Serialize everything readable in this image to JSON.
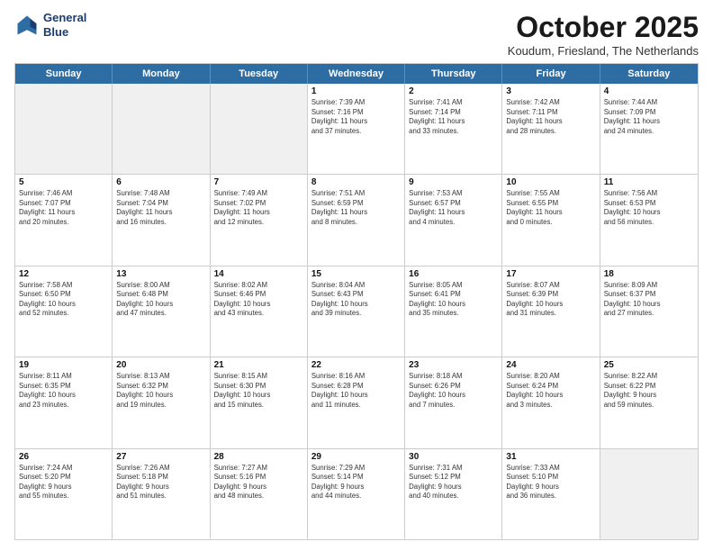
{
  "header": {
    "logo_line1": "General",
    "logo_line2": "Blue",
    "month": "October 2025",
    "location": "Koudum, Friesland, The Netherlands"
  },
  "days": [
    "Sunday",
    "Monday",
    "Tuesday",
    "Wednesday",
    "Thursday",
    "Friday",
    "Saturday"
  ],
  "rows": [
    [
      {
        "day": "",
        "info": ""
      },
      {
        "day": "",
        "info": ""
      },
      {
        "day": "",
        "info": ""
      },
      {
        "day": "1",
        "info": "Sunrise: 7:39 AM\nSunset: 7:16 PM\nDaylight: 11 hours\nand 37 minutes."
      },
      {
        "day": "2",
        "info": "Sunrise: 7:41 AM\nSunset: 7:14 PM\nDaylight: 11 hours\nand 33 minutes."
      },
      {
        "day": "3",
        "info": "Sunrise: 7:42 AM\nSunset: 7:11 PM\nDaylight: 11 hours\nand 28 minutes."
      },
      {
        "day": "4",
        "info": "Sunrise: 7:44 AM\nSunset: 7:09 PM\nDaylight: 11 hours\nand 24 minutes."
      }
    ],
    [
      {
        "day": "5",
        "info": "Sunrise: 7:46 AM\nSunset: 7:07 PM\nDaylight: 11 hours\nand 20 minutes."
      },
      {
        "day": "6",
        "info": "Sunrise: 7:48 AM\nSunset: 7:04 PM\nDaylight: 11 hours\nand 16 minutes."
      },
      {
        "day": "7",
        "info": "Sunrise: 7:49 AM\nSunset: 7:02 PM\nDaylight: 11 hours\nand 12 minutes."
      },
      {
        "day": "8",
        "info": "Sunrise: 7:51 AM\nSunset: 6:59 PM\nDaylight: 11 hours\nand 8 minutes."
      },
      {
        "day": "9",
        "info": "Sunrise: 7:53 AM\nSunset: 6:57 PM\nDaylight: 11 hours\nand 4 minutes."
      },
      {
        "day": "10",
        "info": "Sunrise: 7:55 AM\nSunset: 6:55 PM\nDaylight: 11 hours\nand 0 minutes."
      },
      {
        "day": "11",
        "info": "Sunrise: 7:56 AM\nSunset: 6:53 PM\nDaylight: 10 hours\nand 56 minutes."
      }
    ],
    [
      {
        "day": "12",
        "info": "Sunrise: 7:58 AM\nSunset: 6:50 PM\nDaylight: 10 hours\nand 52 minutes."
      },
      {
        "day": "13",
        "info": "Sunrise: 8:00 AM\nSunset: 6:48 PM\nDaylight: 10 hours\nand 47 minutes."
      },
      {
        "day": "14",
        "info": "Sunrise: 8:02 AM\nSunset: 6:46 PM\nDaylight: 10 hours\nand 43 minutes."
      },
      {
        "day": "15",
        "info": "Sunrise: 8:04 AM\nSunset: 6:43 PM\nDaylight: 10 hours\nand 39 minutes."
      },
      {
        "day": "16",
        "info": "Sunrise: 8:05 AM\nSunset: 6:41 PM\nDaylight: 10 hours\nand 35 minutes."
      },
      {
        "day": "17",
        "info": "Sunrise: 8:07 AM\nSunset: 6:39 PM\nDaylight: 10 hours\nand 31 minutes."
      },
      {
        "day": "18",
        "info": "Sunrise: 8:09 AM\nSunset: 6:37 PM\nDaylight: 10 hours\nand 27 minutes."
      }
    ],
    [
      {
        "day": "19",
        "info": "Sunrise: 8:11 AM\nSunset: 6:35 PM\nDaylight: 10 hours\nand 23 minutes."
      },
      {
        "day": "20",
        "info": "Sunrise: 8:13 AM\nSunset: 6:32 PM\nDaylight: 10 hours\nand 19 minutes."
      },
      {
        "day": "21",
        "info": "Sunrise: 8:15 AM\nSunset: 6:30 PM\nDaylight: 10 hours\nand 15 minutes."
      },
      {
        "day": "22",
        "info": "Sunrise: 8:16 AM\nSunset: 6:28 PM\nDaylight: 10 hours\nand 11 minutes."
      },
      {
        "day": "23",
        "info": "Sunrise: 8:18 AM\nSunset: 6:26 PM\nDaylight: 10 hours\nand 7 minutes."
      },
      {
        "day": "24",
        "info": "Sunrise: 8:20 AM\nSunset: 6:24 PM\nDaylight: 10 hours\nand 3 minutes."
      },
      {
        "day": "25",
        "info": "Sunrise: 8:22 AM\nSunset: 6:22 PM\nDaylight: 9 hours\nand 59 minutes."
      }
    ],
    [
      {
        "day": "26",
        "info": "Sunrise: 7:24 AM\nSunset: 5:20 PM\nDaylight: 9 hours\nand 55 minutes."
      },
      {
        "day": "27",
        "info": "Sunrise: 7:26 AM\nSunset: 5:18 PM\nDaylight: 9 hours\nand 51 minutes."
      },
      {
        "day": "28",
        "info": "Sunrise: 7:27 AM\nSunset: 5:16 PM\nDaylight: 9 hours\nand 48 minutes."
      },
      {
        "day": "29",
        "info": "Sunrise: 7:29 AM\nSunset: 5:14 PM\nDaylight: 9 hours\nand 44 minutes."
      },
      {
        "day": "30",
        "info": "Sunrise: 7:31 AM\nSunset: 5:12 PM\nDaylight: 9 hours\nand 40 minutes."
      },
      {
        "day": "31",
        "info": "Sunrise: 7:33 AM\nSunset: 5:10 PM\nDaylight: 9 hours\nand 36 minutes."
      },
      {
        "day": "",
        "info": ""
      }
    ]
  ]
}
